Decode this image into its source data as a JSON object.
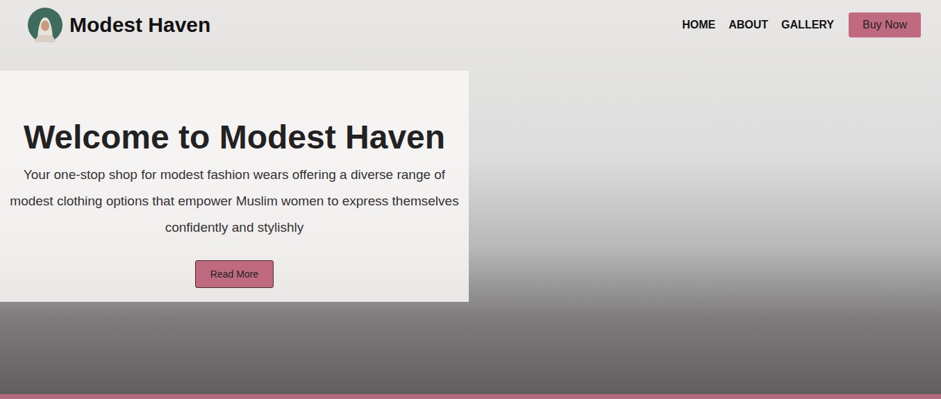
{
  "header": {
    "brand": "Modest Haven",
    "nav": [
      "HOME",
      "ABOUT",
      "GALLERY"
    ],
    "cta": "Buy Now"
  },
  "hero": {
    "title": "Welcome to Modest Haven",
    "text": "Your one-stop shop for modest fashion wears offering a diverse range of modest clothing options that empower Muslim women to express themselves confidently and stylishly",
    "button": "Read More"
  }
}
